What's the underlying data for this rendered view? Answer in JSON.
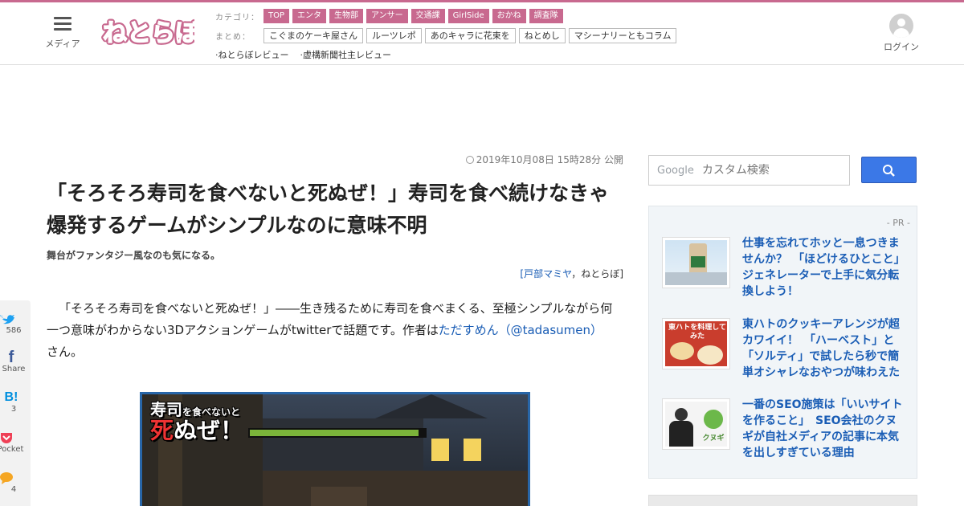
{
  "header": {
    "menu_label": "メディア",
    "logo_text": "ねとらぼ",
    "login_label": "ログイン",
    "category_head": "カテゴリ：",
    "categories": [
      "TOP",
      "エンタ",
      "生物部",
      "アンサー",
      "交通課",
      "GirlSide",
      "おかね",
      "調査隊"
    ],
    "summary_head": "まとめ：",
    "summaries": [
      "こぐまのケーキ屋さん",
      "ルーツレポ",
      "あのキャラに花束を",
      "ねとめし",
      "マシーナリーともコラム"
    ],
    "reviews": [
      "ねとらぼレビュー",
      "虚構新聞社主レビュー"
    ],
    "accent_color": "#c8698f"
  },
  "article": {
    "date": "2019年10月08日 15時28分 公開",
    "title": "「そろそろ寿司を食べないと死ぬぜ！」寿司を食べ続けなきゃ爆発するゲームがシンプルなのに意味不明",
    "subtitle": "舞台がファンタジー風なのも気になる。",
    "byline_open": "[",
    "byline_author": "戸部マミヤ",
    "byline_sep": "，",
    "byline_site": "ねとらぼ",
    "byline_close": "]",
    "body_1": "「そろそろ寿司を食べないと死ぬぜ！」――生き残るために寿司を食べまくる、至極シンプルながら何一つ意味がわからない3Dアクションゲームがtwitterで話題です。作者は",
    "author_link": "ただすめん（@tadasumen）",
    "body_2": "さん。",
    "game_caption_1a": "寿司",
    "game_caption_1b": "を食べないと",
    "game_caption_2a": "死",
    "game_caption_2b": "ぬぜ！"
  },
  "share": [
    {
      "icon": "twitter-icon",
      "label": "586"
    },
    {
      "icon": "facebook-icon",
      "label": "Share"
    },
    {
      "icon": "hatena-icon",
      "label": "3"
    },
    {
      "icon": "pocket-icon",
      "label": "Pocket"
    },
    {
      "icon": "comment-icon",
      "label": "4"
    }
  ],
  "search": {
    "google_label": "Google",
    "placeholder": "カスタム検索"
  },
  "pr": {
    "label": "- PR -",
    "items": [
      {
        "text": "仕事を忘れてホッと一息つきませんか？　「ほどけるひとこと」ジェネレーターで上手に気分転換しよう！"
      },
      {
        "text": "東ハトのクッキーアレンジが超カワイイ！　「ハーベスト」と「ソルティ」で試したら秒で簡単オシャレなおやつが味わえた",
        "thumb_text": "東ハトを料理してみた"
      },
      {
        "text": "一番のSEO施策は「いいサイトを作ること」　SEO会社のクヌギが自社メディアの記事に本気を出しすぎている理由",
        "thumb_text": "クヌギ"
      }
    ]
  }
}
